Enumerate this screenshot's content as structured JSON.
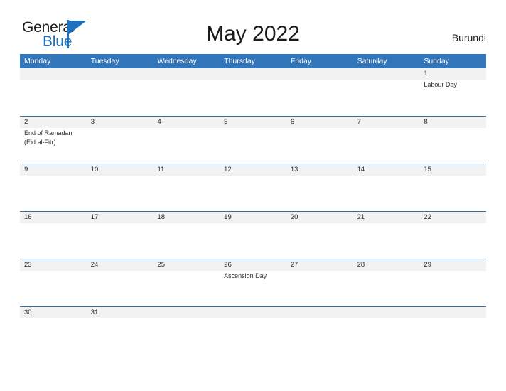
{
  "brand": {
    "name_part1": "General",
    "name_part2": "Blue",
    "color_dark": "#231f20",
    "color_blue": "#1f72bd"
  },
  "header": {
    "title": "May 2022",
    "country": "Burundi"
  },
  "theme": {
    "header_blue": "#3275b8",
    "row_border_blue": "#2e6da4",
    "date_band_gray": "#f2f2f2",
    "text_color": "#2b2b2b"
  },
  "calendar": {
    "weekdays": [
      "Monday",
      "Tuesday",
      "Wednesday",
      "Thursday",
      "Friday",
      "Saturday",
      "Sunday"
    ],
    "weeks": [
      {
        "days": [
          {
            "date": "",
            "events": []
          },
          {
            "date": "",
            "events": []
          },
          {
            "date": "",
            "events": []
          },
          {
            "date": "",
            "events": []
          },
          {
            "date": "",
            "events": []
          },
          {
            "date": "",
            "events": []
          },
          {
            "date": "1",
            "events": [
              "Labour Day"
            ]
          }
        ]
      },
      {
        "days": [
          {
            "date": "2",
            "events": [
              "End of Ramadan",
              "(Eid al-Fitr)"
            ]
          },
          {
            "date": "3",
            "events": []
          },
          {
            "date": "4",
            "events": []
          },
          {
            "date": "5",
            "events": []
          },
          {
            "date": "6",
            "events": []
          },
          {
            "date": "7",
            "events": []
          },
          {
            "date": "8",
            "events": []
          }
        ]
      },
      {
        "days": [
          {
            "date": "9",
            "events": []
          },
          {
            "date": "10",
            "events": []
          },
          {
            "date": "11",
            "events": []
          },
          {
            "date": "12",
            "events": []
          },
          {
            "date": "13",
            "events": []
          },
          {
            "date": "14",
            "events": []
          },
          {
            "date": "15",
            "events": []
          }
        ]
      },
      {
        "days": [
          {
            "date": "16",
            "events": []
          },
          {
            "date": "17",
            "events": []
          },
          {
            "date": "18",
            "events": []
          },
          {
            "date": "19",
            "events": []
          },
          {
            "date": "20",
            "events": []
          },
          {
            "date": "21",
            "events": []
          },
          {
            "date": "22",
            "events": []
          }
        ]
      },
      {
        "days": [
          {
            "date": "23",
            "events": []
          },
          {
            "date": "24",
            "events": []
          },
          {
            "date": "25",
            "events": []
          },
          {
            "date": "26",
            "events": [
              "Ascension Day"
            ]
          },
          {
            "date": "27",
            "events": []
          },
          {
            "date": "28",
            "events": []
          },
          {
            "date": "29",
            "events": []
          }
        ]
      },
      {
        "days": [
          {
            "date": "30",
            "events": []
          },
          {
            "date": "31",
            "events": []
          },
          {
            "date": "",
            "events": []
          },
          {
            "date": "",
            "events": []
          },
          {
            "date": "",
            "events": []
          },
          {
            "date": "",
            "events": []
          },
          {
            "date": "",
            "events": []
          }
        ]
      }
    ]
  }
}
